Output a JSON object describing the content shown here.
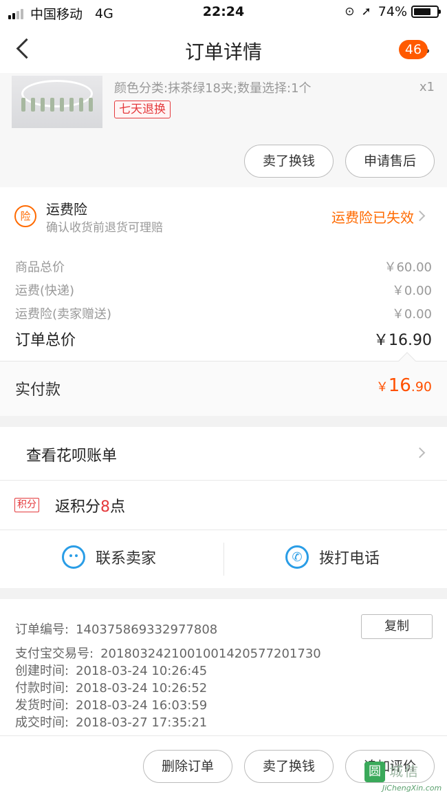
{
  "status_bar": {
    "carrier": "中国移动",
    "network": "4G",
    "time": "22:24",
    "battery": "74%",
    "battery_level": 0.74
  },
  "nav": {
    "title": "订单详情",
    "badge": "46"
  },
  "product": {
    "spec": "颜色分类:抹茶绿18夹;数量选择:1个",
    "qty": "x1",
    "return_tag": "七天退换",
    "sell_button": "卖了换钱",
    "after_sale_button": "申请售后"
  },
  "insurance": {
    "icon_char": "险",
    "title": "运费险",
    "subtitle": "确认收货前退货可理赔",
    "status": "运费险已失效"
  },
  "prices": {
    "goods_label": "商品总价",
    "goods_value": "￥60.00",
    "shipping_label": "运费(快递)",
    "shipping_value": "￥0.00",
    "insurance_label": "运费险(卖家赠送)",
    "insurance_value": "￥0.00",
    "total_label": "订单总价",
    "total_value": "￥16.90"
  },
  "paid": {
    "label": "实付款",
    "currency": "￥",
    "int": "16",
    "dec": ".90"
  },
  "huabei": {
    "label": "查看花呗账单"
  },
  "points": {
    "tag": "积分",
    "prefix": "返积分",
    "num": "8",
    "suffix": "点"
  },
  "contact": {
    "seller": "联系卖家",
    "phone": "拨打电话"
  },
  "order_info": {
    "order_no_label": "订单编号:",
    "order_no": "140375869332977808",
    "copy_button": "复制",
    "alipay_label": "支付宝交易号:",
    "alipay_no": "2018032421001001420577201730",
    "created_label": "创建时间:",
    "created": "2018-03-24 10:26:45",
    "paid_label": "付款时间:",
    "paid_time": "2018-03-24 10:26:52",
    "shipped_label": "发货时间:",
    "shipped": "2018-03-24 16:03:59",
    "done_label": "成交时间:",
    "done": "2018-03-27 17:35:21"
  },
  "actions": {
    "delete": "删除订单",
    "sell": "卖了换钱",
    "review": "追加评价"
  },
  "watermark": {
    "mark": "圆",
    "text": "城信",
    "url": "JiChengXin.com"
  }
}
